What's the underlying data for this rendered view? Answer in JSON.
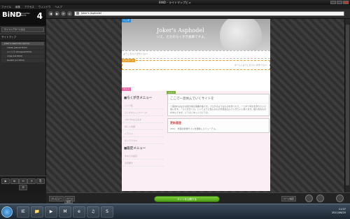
{
  "window": {
    "title": "BiND - ライトマップビュ"
  },
  "menubar": {
    "items": [
      "ファイル",
      "編集",
      "アクセス",
      "ウィンドウ",
      "ヘルプ"
    ]
  },
  "left_panel": {
    "logo_main": "BiND",
    "logo_sub": "FOR WEBLIFE",
    "logo_line1": "Ver.4.0 SuperMax",
    "logo_version": "4",
    "site_button": "サイトシアターに戻る",
    "section_title": "サイトマップ",
    "tree_items": [
      {
        "label": "Joker's Asphodel (lyone)",
        "selected": true
      },
      {
        "label": "inside (about.html)",
        "child": true
      },
      {
        "label": "いくとり (foregoal.html)",
        "child": true
      },
      {
        "label": "ninja (lst.html)",
        "child": true
      },
      {
        "label": "bankill (on.html)",
        "child": true
      }
    ],
    "bottom_buttons": [
      "▶",
      "⊞",
      "⟲",
      "✕",
      "⎘",
      "☰"
    ]
  },
  "toolbar": {
    "nav_buttons": [
      "◀",
      "▶",
      "⟳",
      "⌂"
    ],
    "address": "Joker's Asphodel"
  },
  "page": {
    "header_tag": "ヘッダ",
    "header_title": "Joker's Asphodel",
    "header_sub": "いえ、ただのらくがき倉庫ですよ。",
    "strip_text": "ようこそ(らくがきぐら)へ",
    "billboard_tag": "ビルボード",
    "billboard_text": "ホーム＞ようこそ(らくがきぐら)へ",
    "side_tag": "サイド",
    "main_tag": "メイン",
    "side_menu1_title": "■らくがきメニュー",
    "side_menu1_items": [
      "リンク集",
      "らくがき(トップページ)",
      "つれづれなるまま",
      "詳しい内容",
      "イラスト",
      "ボツラクガキ"
    ],
    "side_menu2_title": "■設定メニュー",
    "side_menu2_items": [
      "あなたの設定",
      "注意書き"
    ],
    "main_box1_head": "ここで一息休んでいくサイトを",
    "main_box1_body": "一度訪れはなかば自分用の落書き帳です。ブログのようなものを作ったり、一つずつ何かを作りたいと思います。「らくがきぐら」というように色んなものを詰め込んでいきたいと思います。個人的なものが中心ですが、どうぞごゆっくりどうぞ。",
    "main_box2_head": "更新履歴",
    "main_box2_body": "2011　外部の新規サイトを更新しリニューアル。"
  },
  "bottombar": {
    "preview_btn": "プレビュー",
    "page_btn": "ページ",
    "page2_btn": "設定",
    "publish_btn": "サイトを公開する",
    "upload_btn": "ページ設定"
  },
  "taskbar": {
    "apps": [
      "IE",
      "📁",
      "▶",
      "M",
      "e",
      "♫",
      "S"
    ],
    "time": "11:07",
    "date": "2011/06/20"
  }
}
